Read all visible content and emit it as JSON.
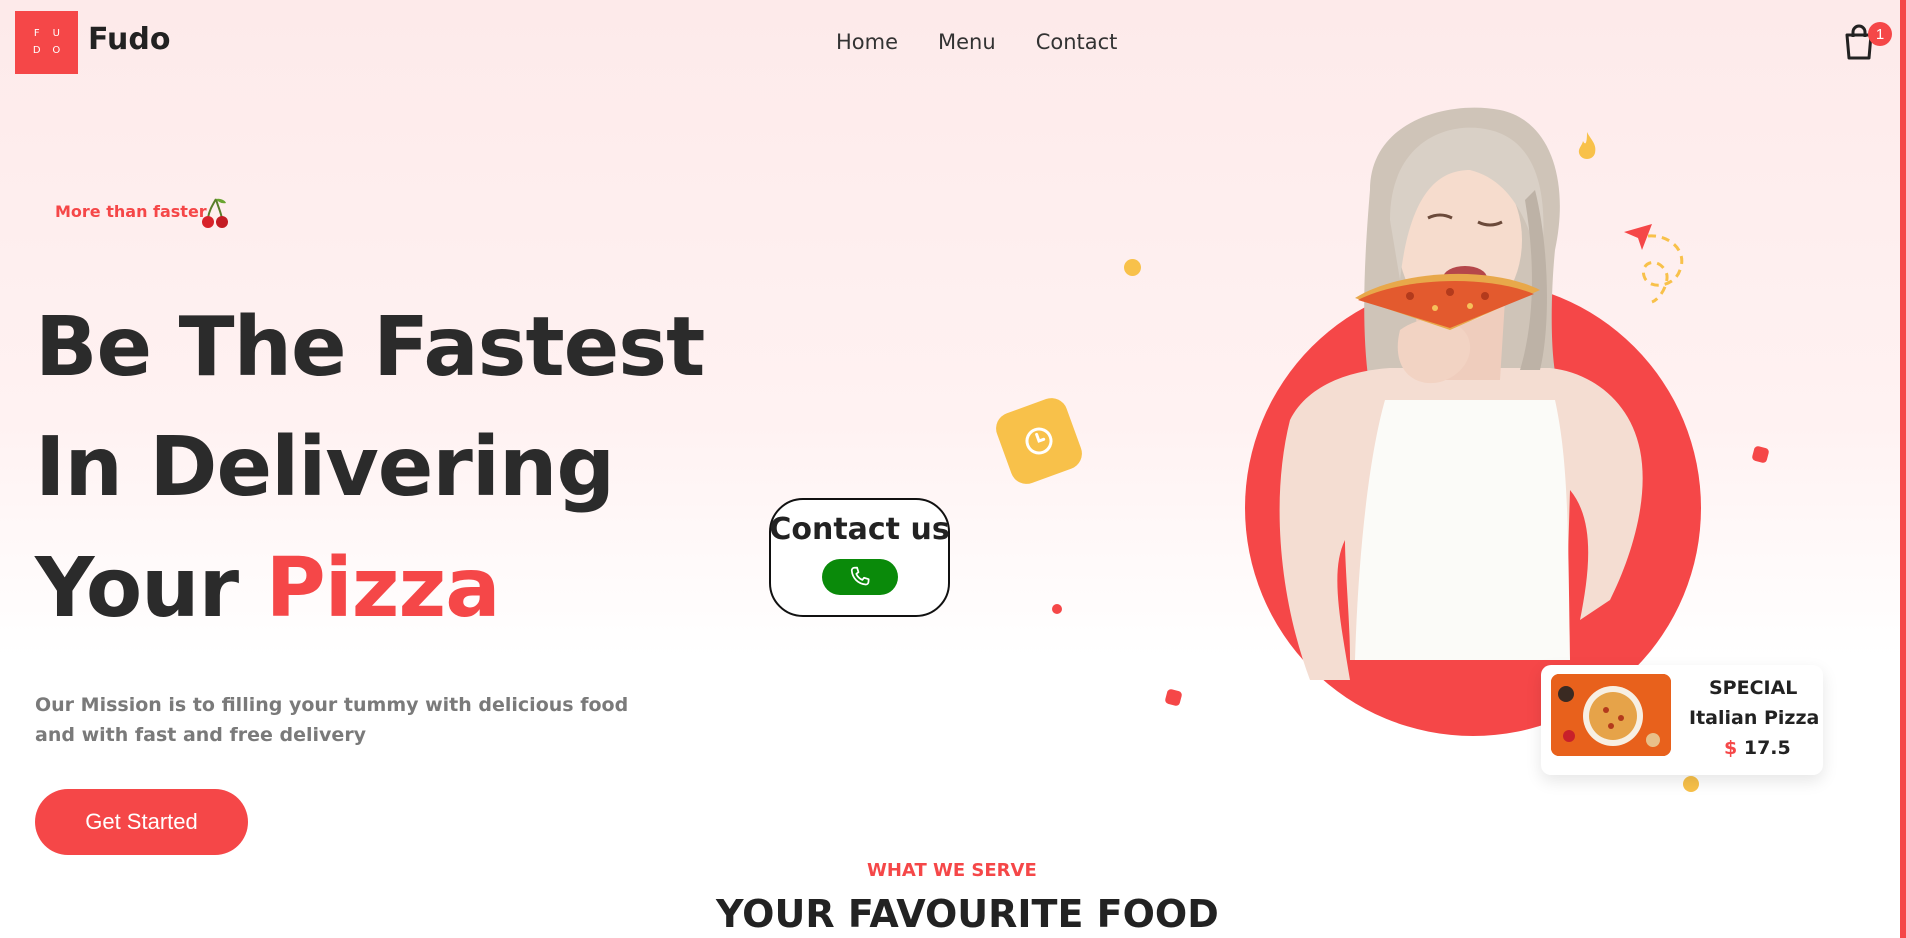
{
  "header": {
    "logo_letters": [
      "F",
      "U",
      "D",
      "O"
    ],
    "brand": "Fudo",
    "nav": [
      "Home",
      "Menu",
      "Contact"
    ],
    "cart_count": "1"
  },
  "hero": {
    "tagline": "More than faster",
    "line1": "Be The Fastest",
    "line2": "In Delivering",
    "line3_prefix": "Your ",
    "line3_accent": "Pizza",
    "mission": "Our Mission is to filling your tummy with delicious food and with fast and free delivery",
    "cta": "Get Started"
  },
  "contact": {
    "title": "Contact us"
  },
  "special_card": {
    "label": "SPECIAL",
    "name": "Italian Pizza",
    "currency": "$",
    "price": "17.5"
  },
  "section": {
    "kicker": "WHAT WE SERVE",
    "title": "YOUR FAVOURITE FOOD"
  },
  "colors": {
    "accent": "#f54748",
    "yellow": "#f8c14a",
    "phone_green": "#0a8a0a"
  },
  "icons": [
    "cart-icon",
    "cherry-icon",
    "phone-icon",
    "clock-icon",
    "send-icon",
    "flame-icon"
  ]
}
